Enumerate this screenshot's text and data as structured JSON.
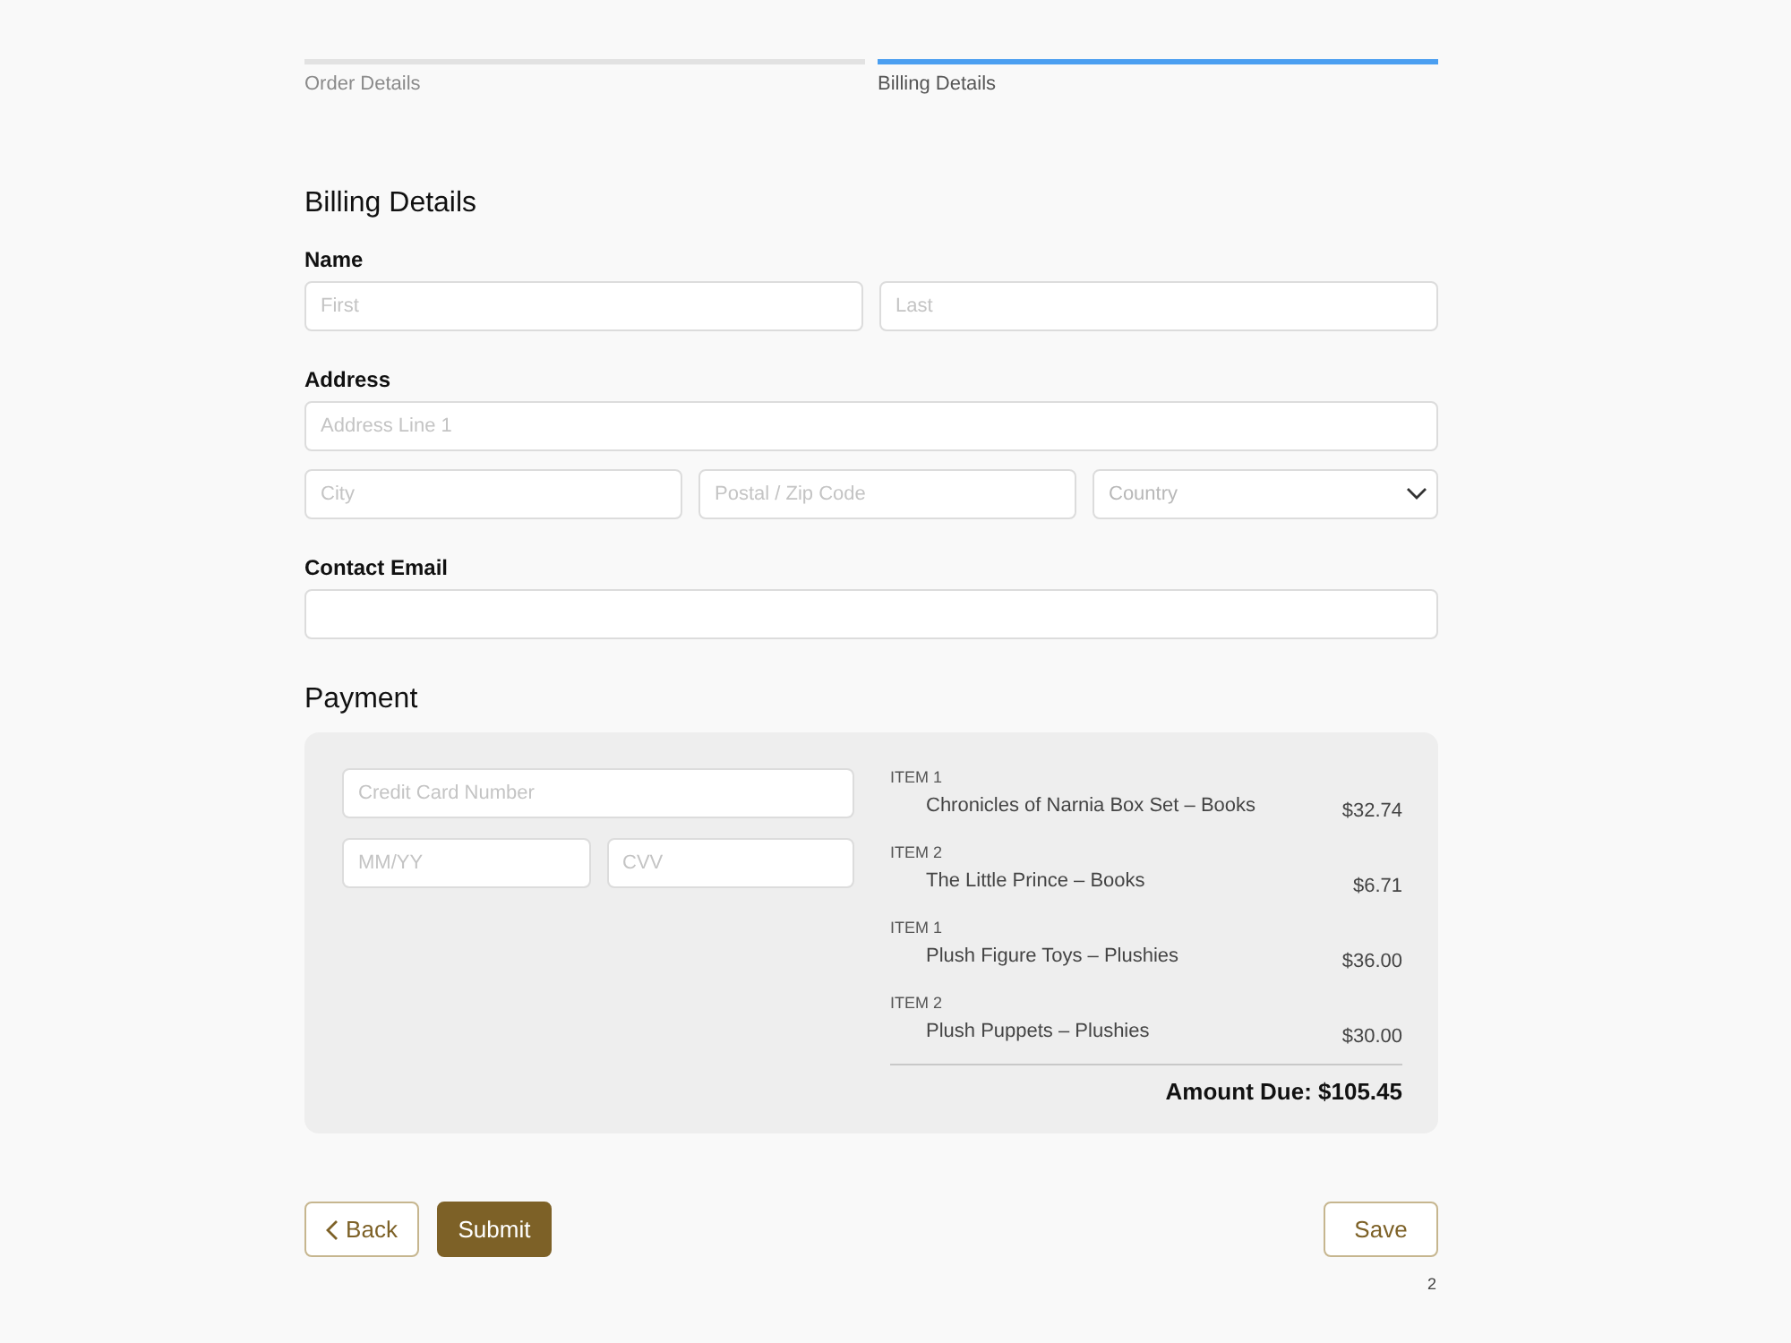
{
  "steps": [
    {
      "label": "Order Details",
      "selected": false
    },
    {
      "label": "Billing Details",
      "selected": true
    }
  ],
  "billing": {
    "title": "Billing Details",
    "groups": [
      {
        "label": "Name",
        "rows": [
          [
            {
              "kind": "input",
              "placeholder": "First"
            },
            {
              "kind": "input",
              "placeholder": "Last"
            }
          ]
        ]
      },
      {
        "label": "Address",
        "rows": [
          [
            {
              "kind": "input",
              "placeholder": "Address Line 1"
            }
          ],
          [
            {
              "kind": "input",
              "placeholder": "City"
            },
            {
              "kind": "input",
              "placeholder": "Postal / Zip Code"
            },
            {
              "kind": "select",
              "placeholder": "Country"
            }
          ]
        ]
      },
      {
        "label": "Contact Email",
        "rows": [
          [
            {
              "kind": "input"
            }
          ]
        ]
      }
    ]
  },
  "payment": {
    "title": "Payment",
    "card_rows": [
      [
        {
          "kind": "input",
          "placeholder": "Credit Card Number"
        }
      ],
      [
        {
          "kind": "input",
          "placeholder": "MM/YY"
        },
        {
          "kind": "input",
          "placeholder": "CVV"
        }
      ]
    ],
    "items": [
      {
        "tag": "ITEM 1",
        "name": "Chronicles of Narnia Box Set – Books",
        "price": "$32.74"
      },
      {
        "tag": "ITEM 2",
        "name": "The Little Prince – Books",
        "price": "$6.71"
      },
      {
        "tag": "ITEM 1",
        "name": "Plush Figure Toys – Plushies",
        "price": "$36.00"
      },
      {
        "tag": "ITEM 2",
        "name": "Plush Puppets – Plushies",
        "price": "$30.00"
      }
    ],
    "amount_due": "Amount Due: $105.45"
  },
  "actions": [
    {
      "label": "Back",
      "kind": "back"
    },
    {
      "label": "Submit",
      "kind": "submit"
    },
    {
      "label": "Save",
      "kind": "save"
    }
  ],
  "page_number": "2"
}
